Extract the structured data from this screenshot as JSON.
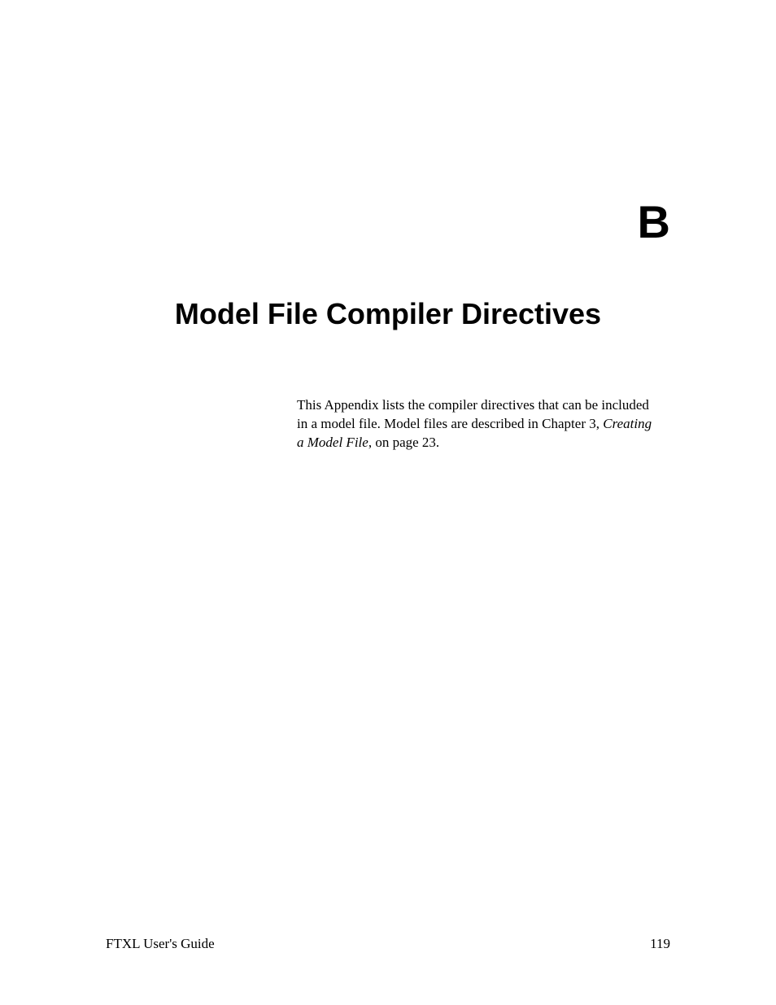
{
  "appendix": {
    "letter": "B",
    "title": "Model File Compiler Directives"
  },
  "intro": {
    "text_before": "This Appendix lists the compiler directives that can be included in a model file.  Model files are described in Chapter 3, ",
    "italic_text": "Creating a Model File",
    "text_after": ", on page 23."
  },
  "footer": {
    "left": "FTXL User's Guide",
    "right": "119"
  }
}
